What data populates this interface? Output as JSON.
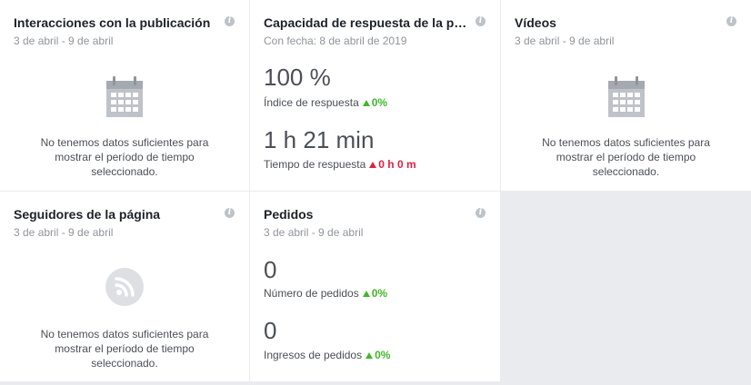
{
  "cards": {
    "interacciones": {
      "title": "Interacciones con la publicación",
      "subtitle": "3 de abril - 9 de abril",
      "empty": "No tenemos datos suficientes para mostrar el período de tiempo seleccionado."
    },
    "capacidad": {
      "title": "Capacidad de respuesta de la página",
      "subtitle": "Con fecha: 8 de abril de 2019",
      "metric1_value": "100 %",
      "metric1_label": "Índice de respuesta",
      "metric1_change": "0%",
      "metric2_value": "1 h 21 min",
      "metric2_label": "Tiempo de respuesta",
      "metric2_change": "0 h 0 m"
    },
    "videos": {
      "title": "Vídeos",
      "subtitle": "3 de abril - 9 de abril",
      "empty": "No tenemos datos suficientes para mostrar el período de tiempo seleccionado."
    },
    "seguidores": {
      "title": "Seguidores de la página",
      "subtitle": "3 de abril - 9 de abril",
      "empty": "No tenemos datos suficientes para mostrar el período de tiempo seleccionado."
    },
    "pedidos": {
      "title": "Pedidos",
      "subtitle": "3 de abril - 9 de abril",
      "metric1_value": "0",
      "metric1_label": "Número de pedidos",
      "metric1_change": "0%",
      "metric2_value": "0",
      "metric2_label": "Ingresos de pedidos",
      "metric2_change": "0%"
    }
  },
  "icons": {
    "info": "info-icon",
    "calendar": "calendar-icon",
    "rss": "rss-icon"
  },
  "colors": {
    "positive": "#42b72a",
    "negative": "#e41e3f",
    "background": "#e9ebee"
  }
}
